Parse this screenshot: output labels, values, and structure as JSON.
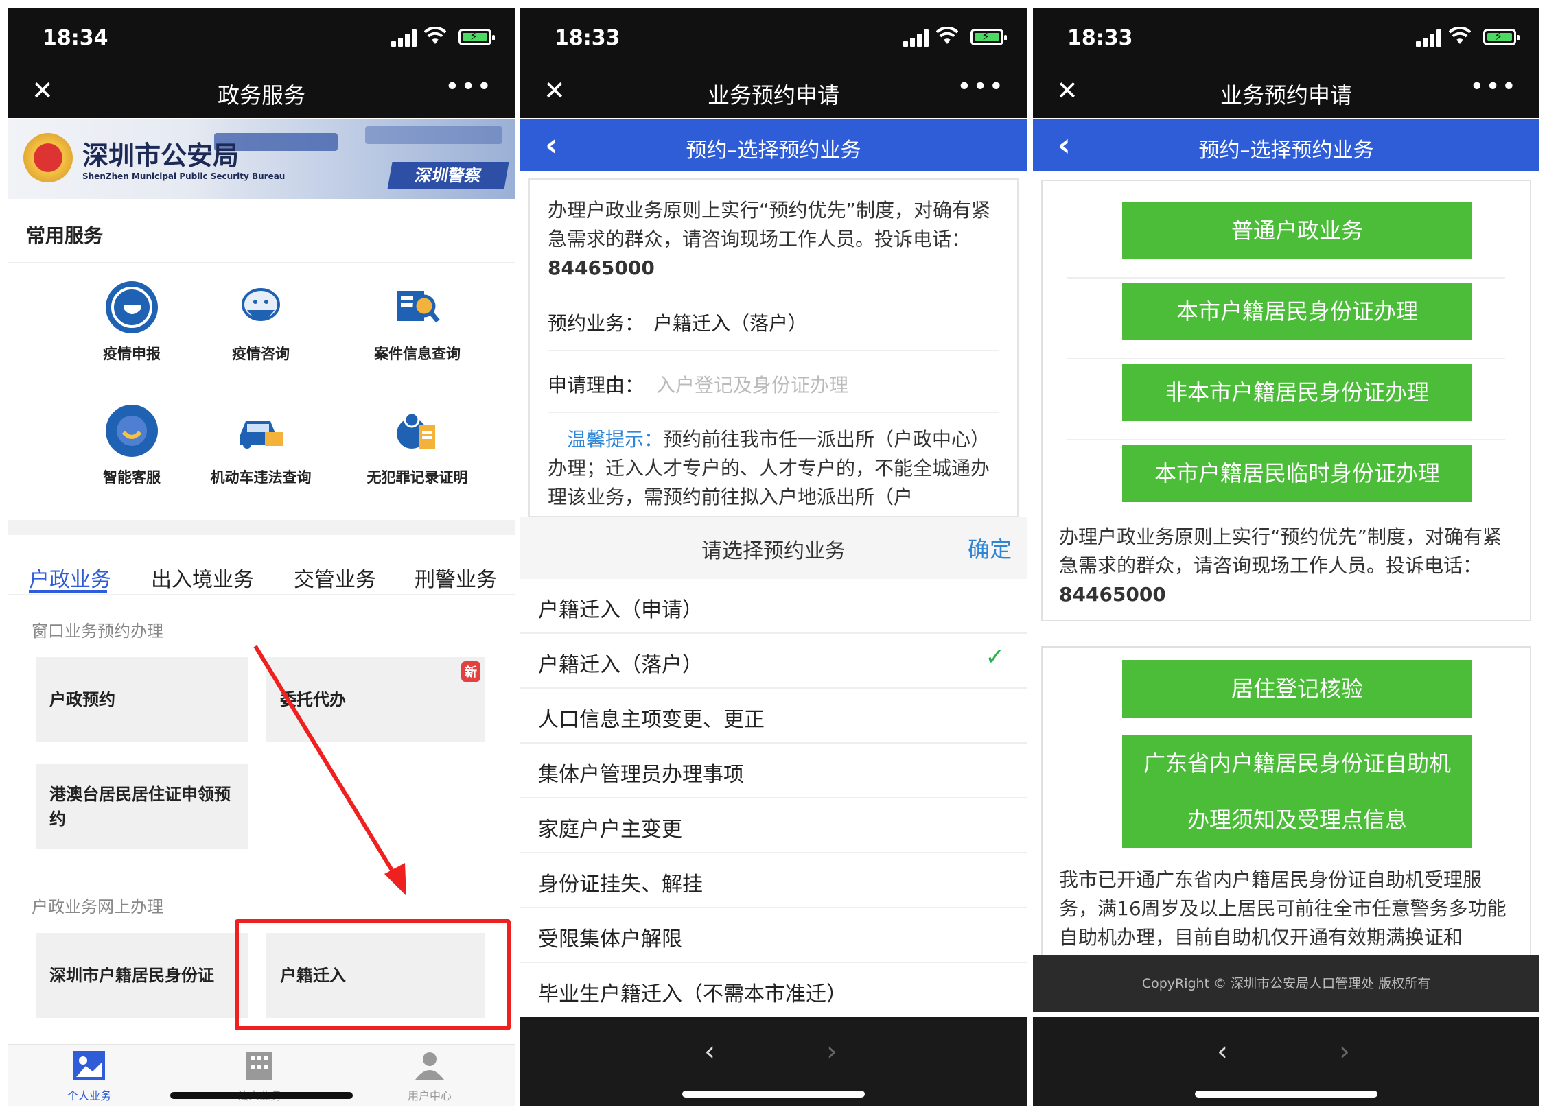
{
  "panel1": {
    "time": "18:34",
    "title": "政务服务",
    "banner": {
      "name": "深圳市公安局",
      "name_en": "ShenZhen Municipal Public Security Bureau",
      "sign": "深圳警察"
    },
    "common_title": "常用服务",
    "services": [
      {
        "label": "疫情申报",
        "icon": "mask-person-icon"
      },
      {
        "label": "疫情咨询",
        "icon": "mask-robot-icon"
      },
      {
        "label": "案件信息查询",
        "icon": "search-document-icon"
      },
      {
        "label": "智能客服",
        "icon": "headset-icon"
      },
      {
        "label": "机动车违法查询",
        "icon": "car-icon"
      },
      {
        "label": "无犯罪记录证明",
        "icon": "certificate-icon"
      }
    ],
    "tabs": [
      "户政业务",
      "出入境业务",
      "交管业务",
      "刑警业务"
    ],
    "group1": "窗口业务预约办理",
    "cards1": [
      "户政预约",
      "委托代办",
      "港澳台居民居住证申领预约"
    ],
    "new_badge": "新",
    "group2": "户政业务网上办理",
    "cards2": [
      "深圳市户籍居民身份证",
      "户籍迁入"
    ],
    "nav": [
      "个人业务",
      "法人业务",
      "用户中心"
    ],
    "accent": "#2f5dd8",
    "highlight": "#ef2020"
  },
  "panel2": {
    "time": "18:33",
    "title": "业务预约申请",
    "subtitle": "预约–选择预约业务",
    "notice_pre": "办理户政业务原则上实行“预约优先”制度，对确有紧急需求的群众，请咨询现场工作人员。投诉电话：",
    "phone": "84465000",
    "biz_label": "预约业务：",
    "biz_value": "户籍迁入（落户）",
    "reason_label": "申请理由：",
    "reason_placeholder": "入户登记及身份证办理",
    "tip_label": "温馨提示：",
    "tip_text": "预约前往我市任一派出所（户政中心）办理；迁入人才专户的、人才专户的，不能全城通办理该业务，需预约前往拟入户地派出所（户",
    "picker_title": "请选择预约业务",
    "picker_ok": "确定",
    "options": [
      "户籍迁入（申请）",
      "户籍迁入（落户）",
      "人口信息主项变更、更正",
      "集体户管理员办理事项",
      "家庭户户主变更",
      "身份证挂失、解挂",
      "受限集体户解限",
      "毕业生户籍迁入（不需本市准迁）"
    ],
    "selected_index": 1,
    "check": "✓"
  },
  "panel3": {
    "time": "18:33",
    "title": "业务预约申请",
    "subtitle": "预约–选择预约业务",
    "buttons1": [
      "普通户政业务",
      "本市户籍居民身份证办理",
      "非本市户籍居民身份证办理",
      "本市户籍居民临时身份证办理"
    ],
    "notice_pre": "办理户政业务原则上实行“预约优先”制度，对确有紧急需求的群众，请咨询现场工作人员。投诉电话：",
    "phone": "84465000",
    "button_residence": "居住登记核验",
    "button_kiosk_line1": "广东省内户籍居民身份证自助机",
    "button_kiosk_line2": "办理须知及受理点信息",
    "kiosk_notice": "我市已开通广东省内户籍居民身份证自助机受理服务，满16周岁及以上居民可前往全市任意警务多功能自助机办理，目前自助机仅开通有效期满换证和",
    "copyright": "CopyRight © 深圳市公安局人口管理处 版权所有",
    "button_color": "#4bbd39"
  },
  "common": {
    "close": "✕",
    "more": "•••",
    "back": "‹",
    "prev": "‹",
    "next": "›"
  }
}
